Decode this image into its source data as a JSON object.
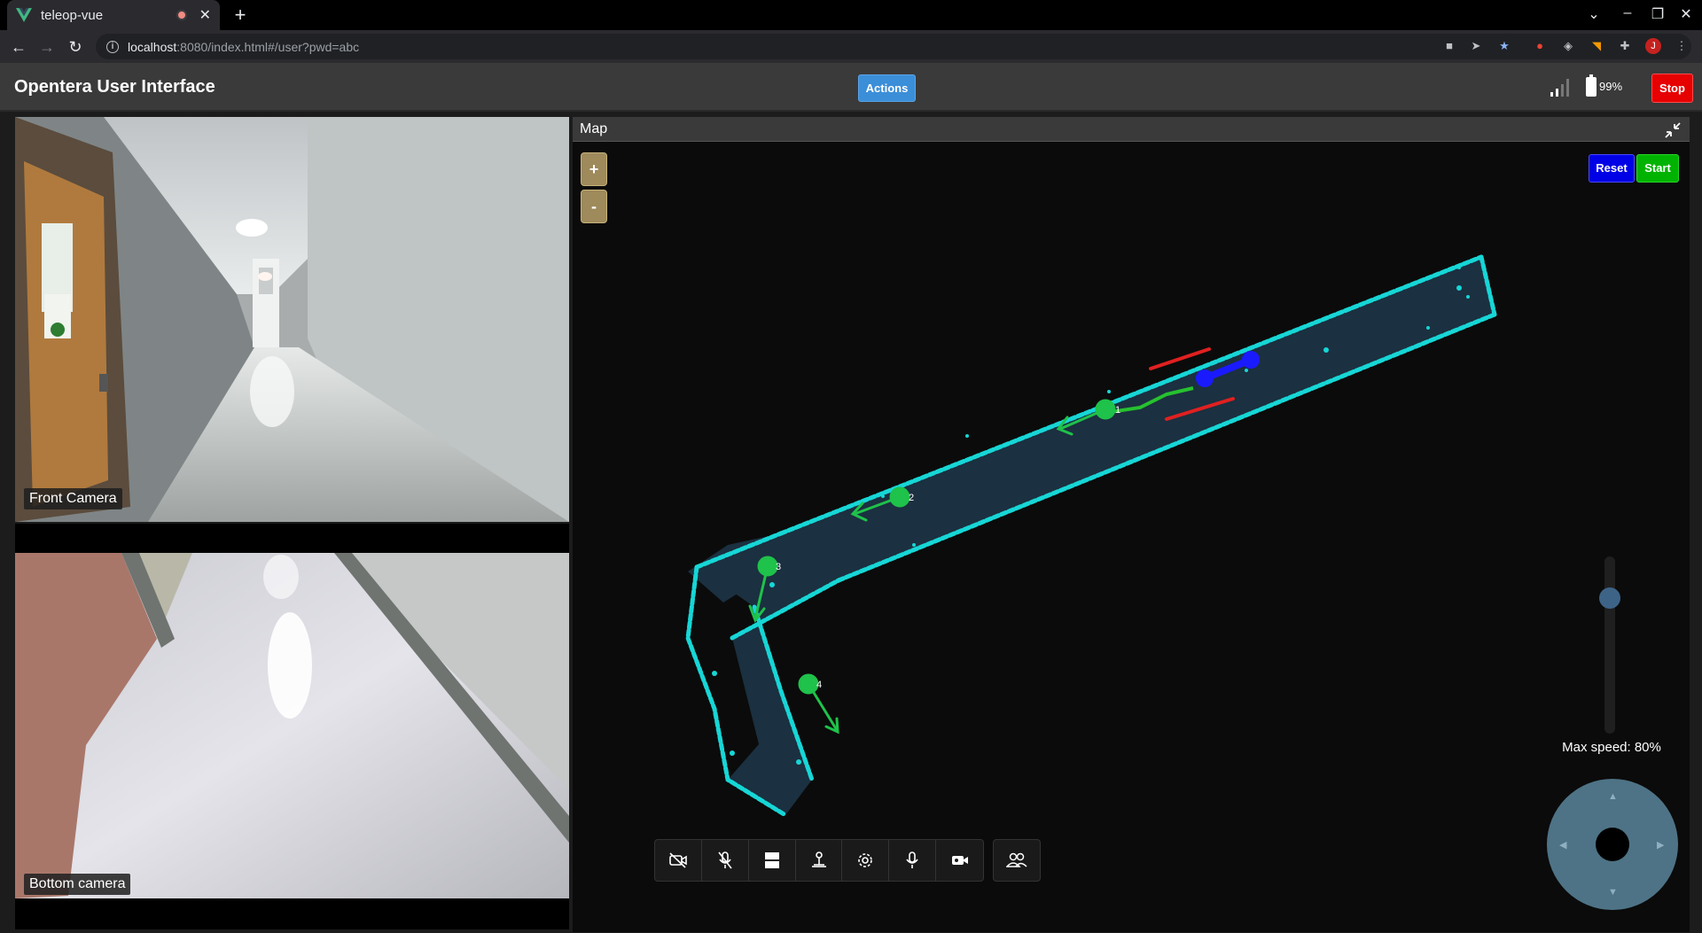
{
  "browser": {
    "tab_title": "teleop-vue",
    "url_host": "localhost",
    "url_path": ":8080/index.html#/user?pwd=abc",
    "profile_initial": "J"
  },
  "app": {
    "title": "Opentera User Interface",
    "actions_label": "Actions",
    "battery_level": "99%",
    "stop_label": "Stop"
  },
  "cameras": {
    "front_label": "Front Camera",
    "bottom_label": "Bottom camera"
  },
  "map": {
    "title": "Map",
    "zoom_in_label": "+",
    "zoom_out_label": "-",
    "reset_label": "Reset",
    "start_label": "Start",
    "waypoints": [
      "1",
      "2",
      "3",
      "4"
    ],
    "max_speed_text": "Max speed: 80%",
    "max_speed_value": 0.8
  },
  "colors": {
    "reset": "#0000e6",
    "start": "#00b300",
    "stop": "#e60000",
    "actions": "#3b8ed8",
    "waypoint": "#1fc24a",
    "map_walls": "#17d6d6"
  },
  "toolbar_icons": [
    "camera-off-icon",
    "mic-off-icon",
    "layout-icon",
    "map-pin-icon",
    "settings-icon",
    "microphone-icon",
    "video-icon",
    "people-icon"
  ]
}
